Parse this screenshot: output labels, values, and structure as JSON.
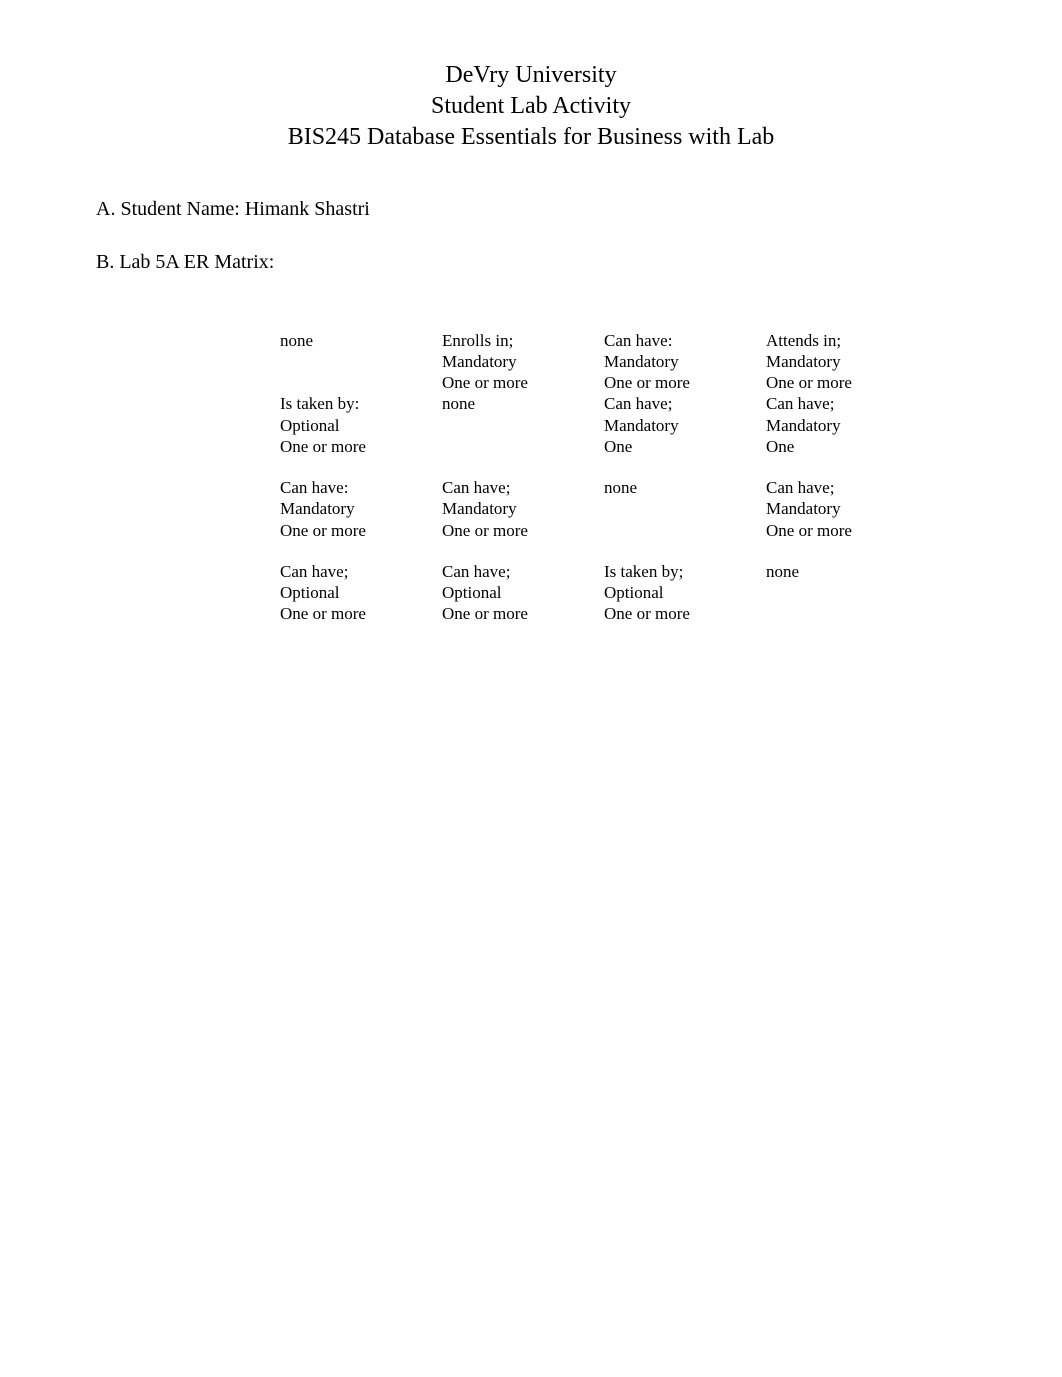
{
  "header": {
    "line1": "DeVry University",
    "line2": "Student Lab Activity",
    "line3": "BIS245 Database Essentials for Business with Lab"
  },
  "sectionA": "A.  Student Name: Himank Shastri",
  "sectionB": "B.    Lab 5A ER Matrix:",
  "matrix": {
    "rows": [
      [
        {
          "l1": "none",
          "l2": "",
          "l3": ""
        },
        {
          "l1": "Enrolls in;",
          "l2": "Mandatory",
          "l3": "One or more"
        },
        {
          "l1": "Can have:",
          "l2": "Mandatory",
          "l3": "One or more"
        },
        {
          "l1": "Attends in;",
          "l2": "Mandatory",
          "l3": "One or more"
        }
      ],
      [
        {
          "l1": "Is taken by:",
          "l2": "Optional",
          "l3": "One or more"
        },
        {
          "l1": "none",
          "l2": "",
          "l3": ""
        },
        {
          "l1": "Can have;",
          "l2": "Mandatory",
          "l3": "One"
        },
        {
          "l1": "Can have;",
          "l2": "Mandatory",
          "l3": "One"
        }
      ],
      [
        {
          "l1": "Can have:",
          "l2": "Mandatory",
          "l3": "One or more"
        },
        {
          "l1": "Can have;",
          "l2": "Mandatory",
          "l3": "One or more"
        },
        {
          "l1": "none",
          "l2": "",
          "l3": ""
        },
        {
          "l1": "Can have;",
          "l2": "Mandatory",
          "l3": "One or more"
        }
      ],
      [
        {
          "l1": "Can have;",
          "l2": "Optional",
          "l3": "One or more"
        },
        {
          "l1": "Can have;",
          "l2": "Optional",
          "l3": "One or more"
        },
        {
          "l1": "Is taken by;",
          "l2": "Optional",
          "l3": "One or more"
        },
        {
          "l1": "none",
          "l2": "",
          "l3": ""
        }
      ]
    ]
  }
}
